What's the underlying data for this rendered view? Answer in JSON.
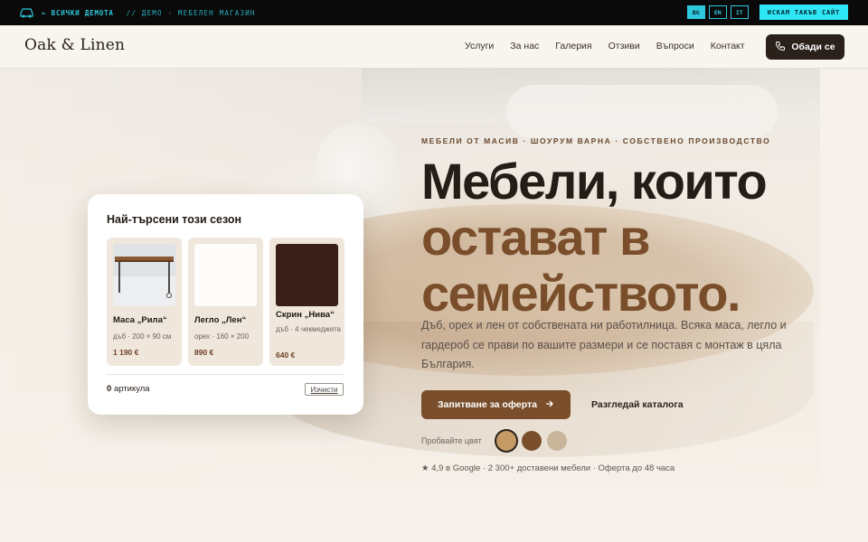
{
  "topbar": {
    "icon": "car-icon",
    "back_label": "← ВСИЧКИ ДЕМОТА",
    "crumb": "// ДЕМО · МЕБЕЛЕН МАГАЗИН",
    "langs": [
      "BG",
      "EN",
      "IT"
    ],
    "active_lang": "BG",
    "want_label": "ИСКАМ ТАКЪВ САЙТ",
    "accent": "#2ec8dc"
  },
  "header": {
    "logo": "Oak & Linen",
    "nav": [
      "Услуги",
      "За нас",
      "Галерия",
      "Отзиви",
      "Въпроси",
      "Контакт"
    ],
    "call_label": "Обади се",
    "call_icon": "phone-icon"
  },
  "hero": {
    "eyebrow": "МЕБЕЛИ ОТ МАСИВ · ШОУРУМ ВАРНА · СОБСТВЕНО ПРОИЗВОДСТВО",
    "title_line1": "Мебели, които",
    "title_line2": "остават в",
    "title_line3": "семейството.",
    "lead": "Дъб, орех и лен от собствената ни работилница. Всяка маса, легло и гардероб се прави по вашите размери и се поставя с монтаж в цяла България.",
    "cta_primary": "Запитване за оферта",
    "cta_primary_icon": "arrow-right-icon",
    "cta_secondary": "Разгледай каталога",
    "try_label": "Пробвайте цвят",
    "swatches": [
      "#c69a65",
      "#7a4e2b",
      "#c9b59a"
    ],
    "selected_swatch": "#c69a65",
    "meta": "★ 4,9 в Google · 2 300+ доставени мебели · Оферта до 48 часа",
    "brand_color": "#7a4e2b"
  },
  "popular": {
    "title": "Най-търсени този сезон",
    "products": [
      {
        "name": "Маса „Рила“",
        "desc": "дъб · 200 × 90 см",
        "price": "1 190 €"
      },
      {
        "name": "Легло „Лен“",
        "desc": "орех · 160 × 200",
        "price": "890 €"
      },
      {
        "name": "Скрин „Нива“",
        "desc": "дъб · 4 чекмеджета",
        "price": "640 €"
      }
    ],
    "count_number": "0",
    "count_label": "артикула",
    "clear_label": "Изчисти"
  }
}
